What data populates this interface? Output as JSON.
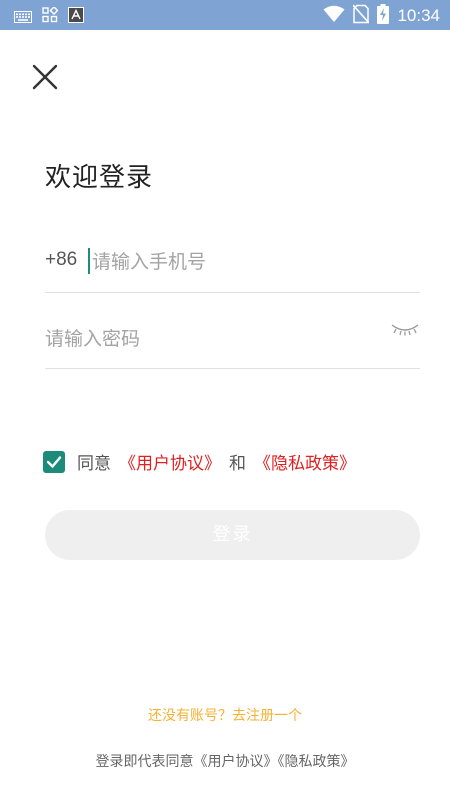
{
  "status_bar": {
    "time": "10:34",
    "left_icons": [
      "keyboard-icon",
      "apps-grid-icon",
      "font-a-icon"
    ],
    "right_icons": [
      "wifi-icon",
      "no-sim-icon",
      "battery-charging-icon"
    ]
  },
  "header": {
    "close_icon": "close-icon"
  },
  "main": {
    "title": "欢迎登录",
    "phone": {
      "country_code": "+86",
      "placeholder": "请输入手机号",
      "value": ""
    },
    "password": {
      "placeholder": "请输入密码",
      "value": "",
      "toggle_icon": "eye-closed-icon"
    },
    "agreement": {
      "checked": true,
      "agree_text": "同意",
      "user_agreement": "《用户协议》",
      "and_text": "和",
      "privacy_policy": "《隐私政策》"
    },
    "login_label": "登录"
  },
  "bottom": {
    "register_link": "还没有账号？去注册一个",
    "footer_note": "登录即代表同意《用户协议》《隐私政策》"
  },
  "colors": {
    "status_bar": "#7fa4d4",
    "accent": "#1c8b7a",
    "link_red": "#e02020",
    "register_link": "#f6b133",
    "button_bg": "#efefef"
  }
}
